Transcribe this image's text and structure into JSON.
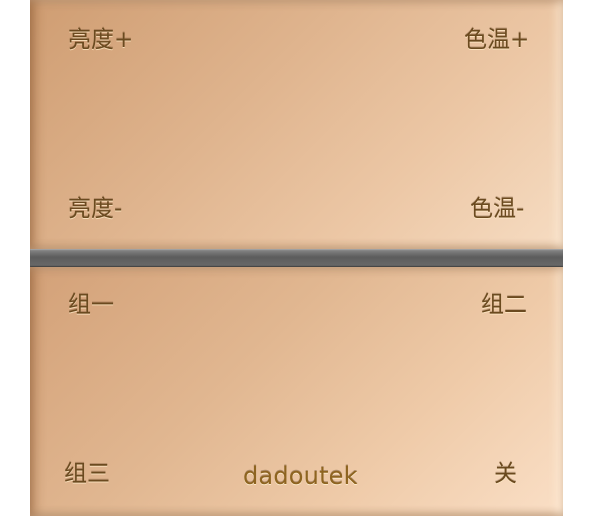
{
  "buttons": {
    "brightness_up": "亮度+",
    "color_temp_up": "色温+",
    "brightness_down": "亮度-",
    "color_temp_down": "色温-",
    "group_one": "组一",
    "group_two": "组二",
    "group_three": "组三",
    "off": "关"
  },
  "brand": "dadoutek",
  "colors": {
    "panel_light": "#f6dcc2",
    "panel_dark": "#cf9d72",
    "divider": "#5c5c5c",
    "text": "#6b4a1f"
  }
}
